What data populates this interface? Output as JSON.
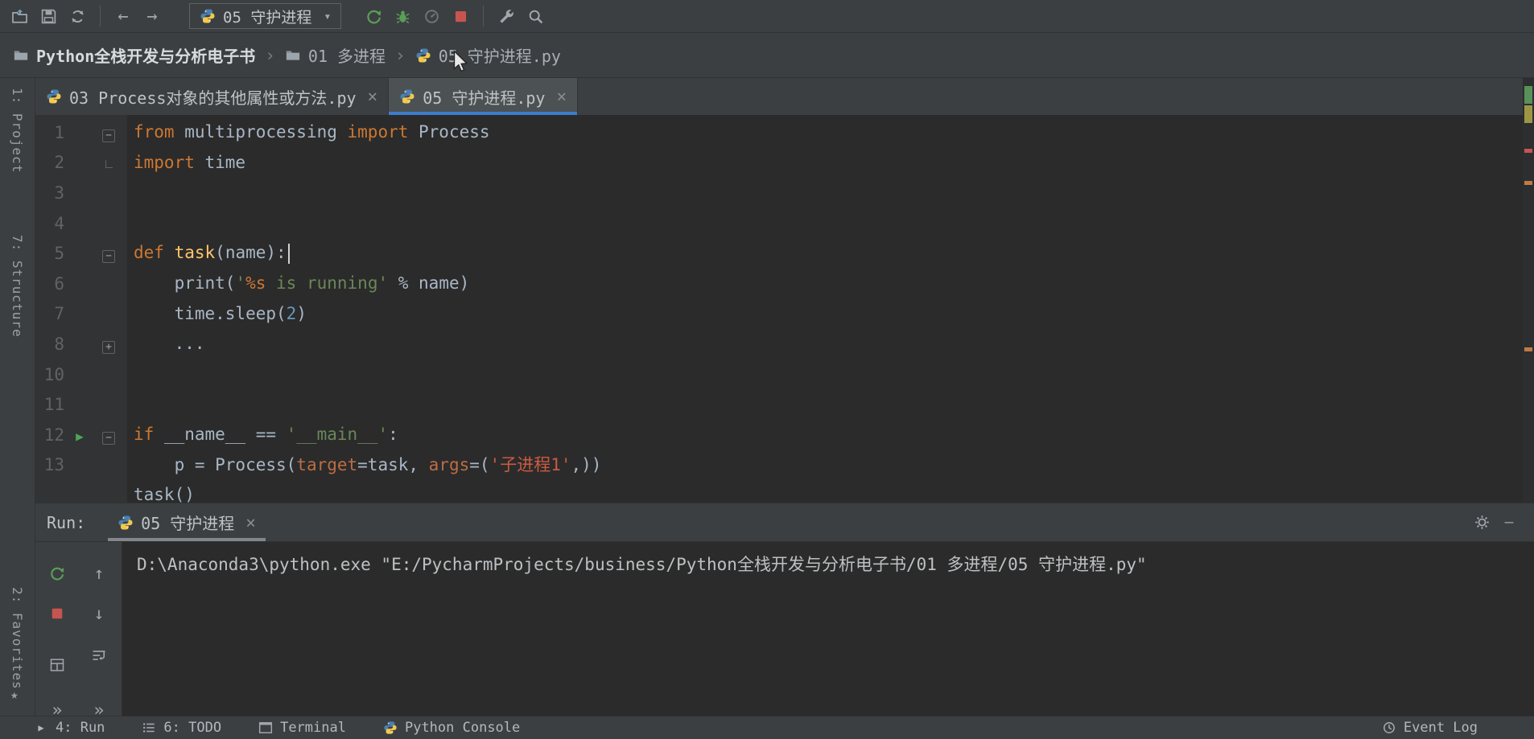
{
  "icons": {
    "back": "←",
    "forward": "→",
    "dropdown": "▾",
    "close": "×",
    "breadcrumb_sep": "›",
    "chevrons": "»",
    "up_arrow": "↑",
    "down_arrow": "↓",
    "star": "★",
    "minus": "—",
    "play_small": "▶",
    "fold_collapse": "−",
    "fold_expand": "+"
  },
  "colors": {
    "panel_bg": "#3c3f41",
    "editor_bg": "#2b2b2b",
    "gutter_bg": "#313335",
    "tab_underline_blue": "#3d7dcb",
    "keyword": "#cc7832",
    "string": "#6a8759",
    "number": "#6897bb",
    "function_name": "#ffc66b",
    "keyword_argument": "#bc6d44",
    "string_highlight": "#cc5a41",
    "default_text": "#a9b7c6",
    "line_number": "#606366",
    "run_green": "#5a9e59",
    "stop_red": "#c75450"
  },
  "toolbar": {
    "run_config_label": "05 守护进程"
  },
  "breadcrumb": {
    "items": [
      "Python全栈开发与分析电子书",
      "01 多进程",
      "05 守护进程.py"
    ]
  },
  "tabs": [
    {
      "label": "03 Process对象的其他属性或方法.py",
      "active": false
    },
    {
      "label": "05 守护进程.py",
      "active": true
    }
  ],
  "left_stripe": {
    "top": [
      "1: Project",
      "7: Structure"
    ],
    "bottom": [
      "2: Favorites"
    ]
  },
  "editor": {
    "lines": [
      {
        "num": "1",
        "fold": "minus",
        "tokens": [
          [
            "kw",
            "from"
          ],
          [
            "d",
            " multiprocessing "
          ],
          [
            "kw",
            "import"
          ],
          [
            "d",
            " Process"
          ]
        ]
      },
      {
        "num": "2",
        "fold": "end",
        "tokens": [
          [
            "kw",
            "import"
          ],
          [
            "d",
            " time"
          ]
        ]
      },
      {
        "num": "3",
        "tokens": []
      },
      {
        "num": "4",
        "tokens": []
      },
      {
        "num": "5",
        "fold": "minus",
        "caret": true,
        "tokens": [
          [
            "kw",
            "def"
          ],
          [
            "d",
            " "
          ],
          [
            "fn",
            "task"
          ],
          [
            "d",
            "(name):"
          ]
        ]
      },
      {
        "num": "6",
        "tokens": [
          [
            "d",
            "    print("
          ],
          [
            "s",
            "'"
          ],
          [
            "fmt",
            "%s"
          ],
          [
            "s",
            " is running'"
          ],
          [
            "d",
            " % name)"
          ]
        ]
      },
      {
        "num": "7",
        "tokens": [
          [
            "d",
            "    time.sleep("
          ],
          [
            "n",
            "2"
          ],
          [
            "d",
            ")"
          ]
        ]
      },
      {
        "num": "8",
        "fold": "plus",
        "tokens": [
          [
            "d",
            "    ..."
          ]
        ]
      },
      {
        "num": "10",
        "tokens": []
      },
      {
        "num": "11",
        "tokens": []
      },
      {
        "num": "12",
        "fold": "minus",
        "run": true,
        "tokens": [
          [
            "kw",
            "if"
          ],
          [
            "d",
            " __name__ == "
          ],
          [
            "s",
            "'__main__'"
          ],
          [
            "d",
            ":"
          ]
        ]
      },
      {
        "num": "13",
        "tokens": [
          [
            "d",
            "    p = Process("
          ],
          [
            "ka",
            "target"
          ],
          [
            "d",
            "=task, "
          ],
          [
            "ka",
            "args"
          ],
          [
            "d",
            "=("
          ],
          [
            "se",
            "'子进程1'"
          ],
          [
            "d",
            ",))"
          ]
        ]
      },
      {
        "num": "",
        "tokens": [
          [
            "d",
            "task()"
          ]
        ]
      }
    ]
  },
  "run_panel": {
    "label": "Run:",
    "tab_label": "05 守护进程",
    "console_text": "D:\\Anaconda3\\python.exe \"E:/PycharmProjects/business/Python全栈开发与分析电子书/01 多进程/05 守护进程.py\""
  },
  "statusbar": {
    "left": [
      {
        "label": "4: Run"
      },
      {
        "label": "6: TODO"
      },
      {
        "label": "Terminal"
      },
      {
        "label": "Python Console"
      }
    ],
    "right": [
      {
        "label": "Event Log"
      }
    ]
  }
}
